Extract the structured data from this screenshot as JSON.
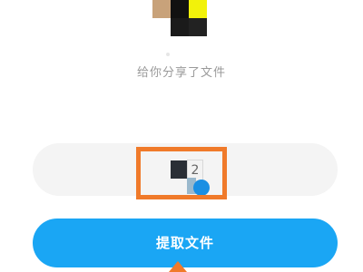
{
  "share": {
    "message": "给你分享了文件"
  },
  "code_input": {
    "digit": "2"
  },
  "actions": {
    "extract_label": "提取文件"
  },
  "colors": {
    "primary": "#1aa6f4",
    "highlight": "#f07a2a",
    "pill_bg": "#f4f4f4",
    "muted_text": "#9a9a9a"
  },
  "icons": {
    "avatar": "pixelated-avatar",
    "pointer": "arrow-up-icon"
  }
}
